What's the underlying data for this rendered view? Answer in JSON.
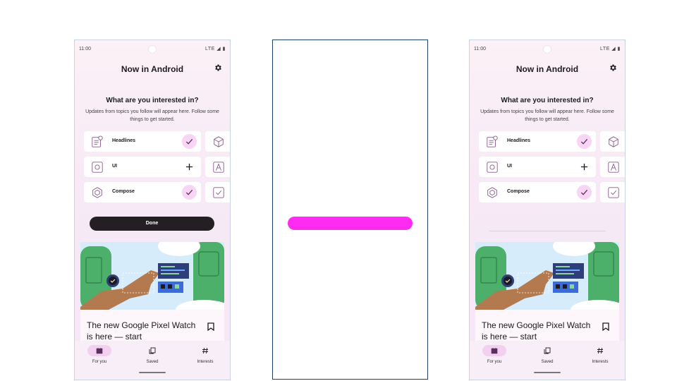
{
  "phone_left": {
    "status": {
      "time": "11:00",
      "icons": "LTE ◢ ▮"
    },
    "app_title": "Now in Android",
    "onboarding": {
      "question": "What are you interested in?",
      "subtext": "Updates from topics you follow will appear here. Follow some things to get started."
    },
    "topics": [
      {
        "label": "Headlines",
        "state": "followed",
        "icon": "news-icon"
      },
      {
        "label": "UI",
        "state": "not-followed",
        "icon": "ui-icon"
      },
      {
        "label": "Compose",
        "state": "followed",
        "icon": "compose-icon"
      }
    ],
    "done_label": "Done",
    "card": {
      "title": "The new Google Pixel Watch is here — start"
    },
    "nav": [
      {
        "label": "For you",
        "icon": "for-you-icon",
        "active": true
      },
      {
        "label": "Saved",
        "icon": "saved-icon",
        "active": false
      },
      {
        "label": "Interests",
        "icon": "hash-icon",
        "active": false
      }
    ]
  },
  "phone_right": {
    "status": {
      "time": "11:00",
      "icons": "LTE ◢ ▮"
    },
    "app_title": "Now in Android",
    "onboarding": {
      "question": "What are you interested in?",
      "subtext": "Updates from topics you follow will appear here. Follow some things to get started."
    },
    "topics": [
      {
        "label": "Headlines",
        "state": "followed",
        "icon": "news-icon"
      },
      {
        "label": "UI",
        "state": "not-followed",
        "icon": "ui-icon"
      },
      {
        "label": "Compose",
        "state": "followed",
        "icon": "compose-icon"
      }
    ],
    "card": {
      "title": "The new Google Pixel Watch is here — start"
    },
    "nav": [
      {
        "label": "For you",
        "icon": "for-you-icon",
        "active": true
      },
      {
        "label": "Saved",
        "icon": "saved-icon",
        "active": false
      },
      {
        "label": "Interests",
        "icon": "hash-icon",
        "active": false
      }
    ]
  },
  "colors": {
    "magenta_bar": "#ff2bf0",
    "done_button": "#231f22",
    "accent_pink": "#f6d5f5",
    "frame_border": "#1e3f66"
  }
}
